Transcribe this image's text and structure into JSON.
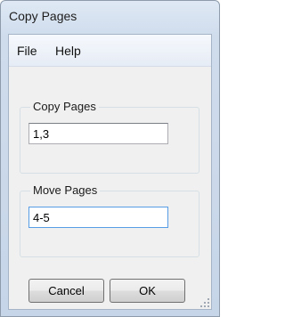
{
  "window": {
    "title": "Copy Pages"
  },
  "menu": {
    "items": [
      {
        "label": "File"
      },
      {
        "label": "Help"
      }
    ]
  },
  "copy_group": {
    "label": "Copy Pages",
    "value": "1,3"
  },
  "move_group": {
    "label": "Move Pages",
    "value": "4-5"
  },
  "buttons": {
    "cancel_label": "Cancel",
    "ok_label": "OK"
  }
}
